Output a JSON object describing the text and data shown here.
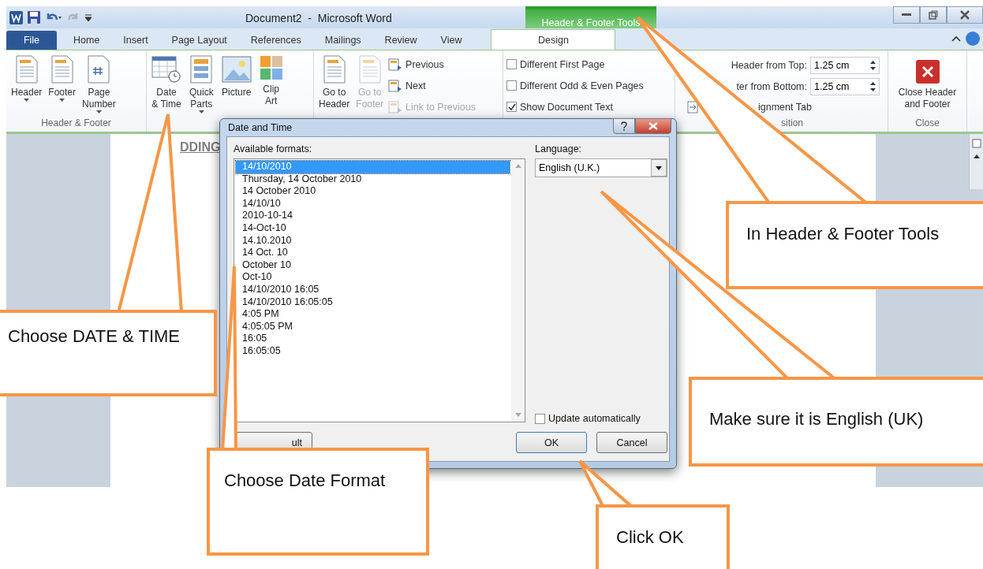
{
  "window": {
    "title": "Document2  -  Microsoft Word",
    "contextual_tab": "Header & Footer Tools"
  },
  "tabs": [
    {
      "label": "File",
      "selected": false,
      "kind": "file"
    },
    {
      "label": "Home",
      "selected": false,
      "kind": "normal"
    },
    {
      "label": "Insert",
      "selected": false,
      "kind": "normal"
    },
    {
      "label": "Page Layout",
      "selected": false,
      "kind": "normal"
    },
    {
      "label": "References",
      "selected": false,
      "kind": "normal"
    },
    {
      "label": "Mailings",
      "selected": false,
      "kind": "normal"
    },
    {
      "label": "Review",
      "selected": false,
      "kind": "normal"
    },
    {
      "label": "View",
      "selected": false,
      "kind": "normal"
    },
    {
      "label": "Design",
      "selected": true,
      "kind": "contextual"
    }
  ],
  "ribbon": {
    "header_footer": {
      "label": "Header & Footer",
      "buttons": [
        {
          "label": "Header",
          "dropdown": true
        },
        {
          "label": "Footer",
          "dropdown": true
        },
        {
          "label": "Page\nNumber",
          "dropdown": true
        }
      ]
    },
    "insert": {
      "buttons": [
        {
          "label": "Date\n& Time",
          "dropdown": false
        },
        {
          "label": "Quick\nParts",
          "dropdown": true
        },
        {
          "label": "Picture",
          "dropdown": false
        },
        {
          "label": "Clip\nArt",
          "dropdown": false
        }
      ]
    },
    "navigation": {
      "large": [
        {
          "label": "Go to\nHeader",
          "disabled": false
        },
        {
          "label": "Go to\nFooter",
          "disabled": true
        }
      ],
      "small": [
        {
          "label": "Previous",
          "disabled": false
        },
        {
          "label": "Next",
          "disabled": false
        },
        {
          "label": "Link to Previous",
          "disabled": true
        }
      ]
    },
    "options": [
      {
        "label": "Different First Page",
        "checked": false
      },
      {
        "label": "Different Odd & Even Pages",
        "checked": false
      },
      {
        "label": "Show Document Text",
        "checked": true
      }
    ],
    "position": {
      "label": "sition",
      "fields": [
        {
          "label": "Header from Top:",
          "value": "1.25 cm"
        },
        {
          "label": "ter from Bottom:",
          "value": "1.25 cm"
        }
      ],
      "tab_button": "ignment Tab"
    },
    "close": {
      "label": "Close",
      "button": "Close Header\nand Footer"
    }
  },
  "document": {
    "header_text": "DDING"
  },
  "dialog": {
    "title": "Date and Time",
    "formats_label": "Available formats:",
    "formats": [
      {
        "text": "14/10/2010",
        "selected": true
      },
      {
        "text": "Thursday, 14 October 2010",
        "selected": false
      },
      {
        "text": "14 October 2010",
        "selected": false
      },
      {
        "text": "14/10/10",
        "selected": false
      },
      {
        "text": "2010-10-14",
        "selected": false
      },
      {
        "text": "14-Oct-10",
        "selected": false
      },
      {
        "text": "14.10.2010",
        "selected": false
      },
      {
        "text": "14 Oct. 10",
        "selected": false
      },
      {
        "text": "October 10",
        "selected": false
      },
      {
        "text": "Oct-10",
        "selected": false
      },
      {
        "text": "14/10/2010 16:05",
        "selected": false
      },
      {
        "text": "14/10/2010 16:05:05",
        "selected": false
      },
      {
        "text": "4:05 PM",
        "selected": false
      },
      {
        "text": "4:05:05 PM",
        "selected": false
      },
      {
        "text": "16:05",
        "selected": false
      },
      {
        "text": "16:05:05",
        "selected": false
      }
    ],
    "language_label": "Language:",
    "language": "English (U.K.)",
    "update_label": "Update automatically",
    "update_checked": false,
    "default_button": "ult",
    "ok_button": "OK",
    "cancel_button": "Cancel"
  },
  "callouts": [
    {
      "text": "In Header & Footer Tools"
    },
    {
      "text": "Choose DATE & TIME"
    },
    {
      "text": "Make sure it is English (UK)"
    },
    {
      "text": "Choose Date Format"
    },
    {
      "text": "Click OK"
    }
  ]
}
